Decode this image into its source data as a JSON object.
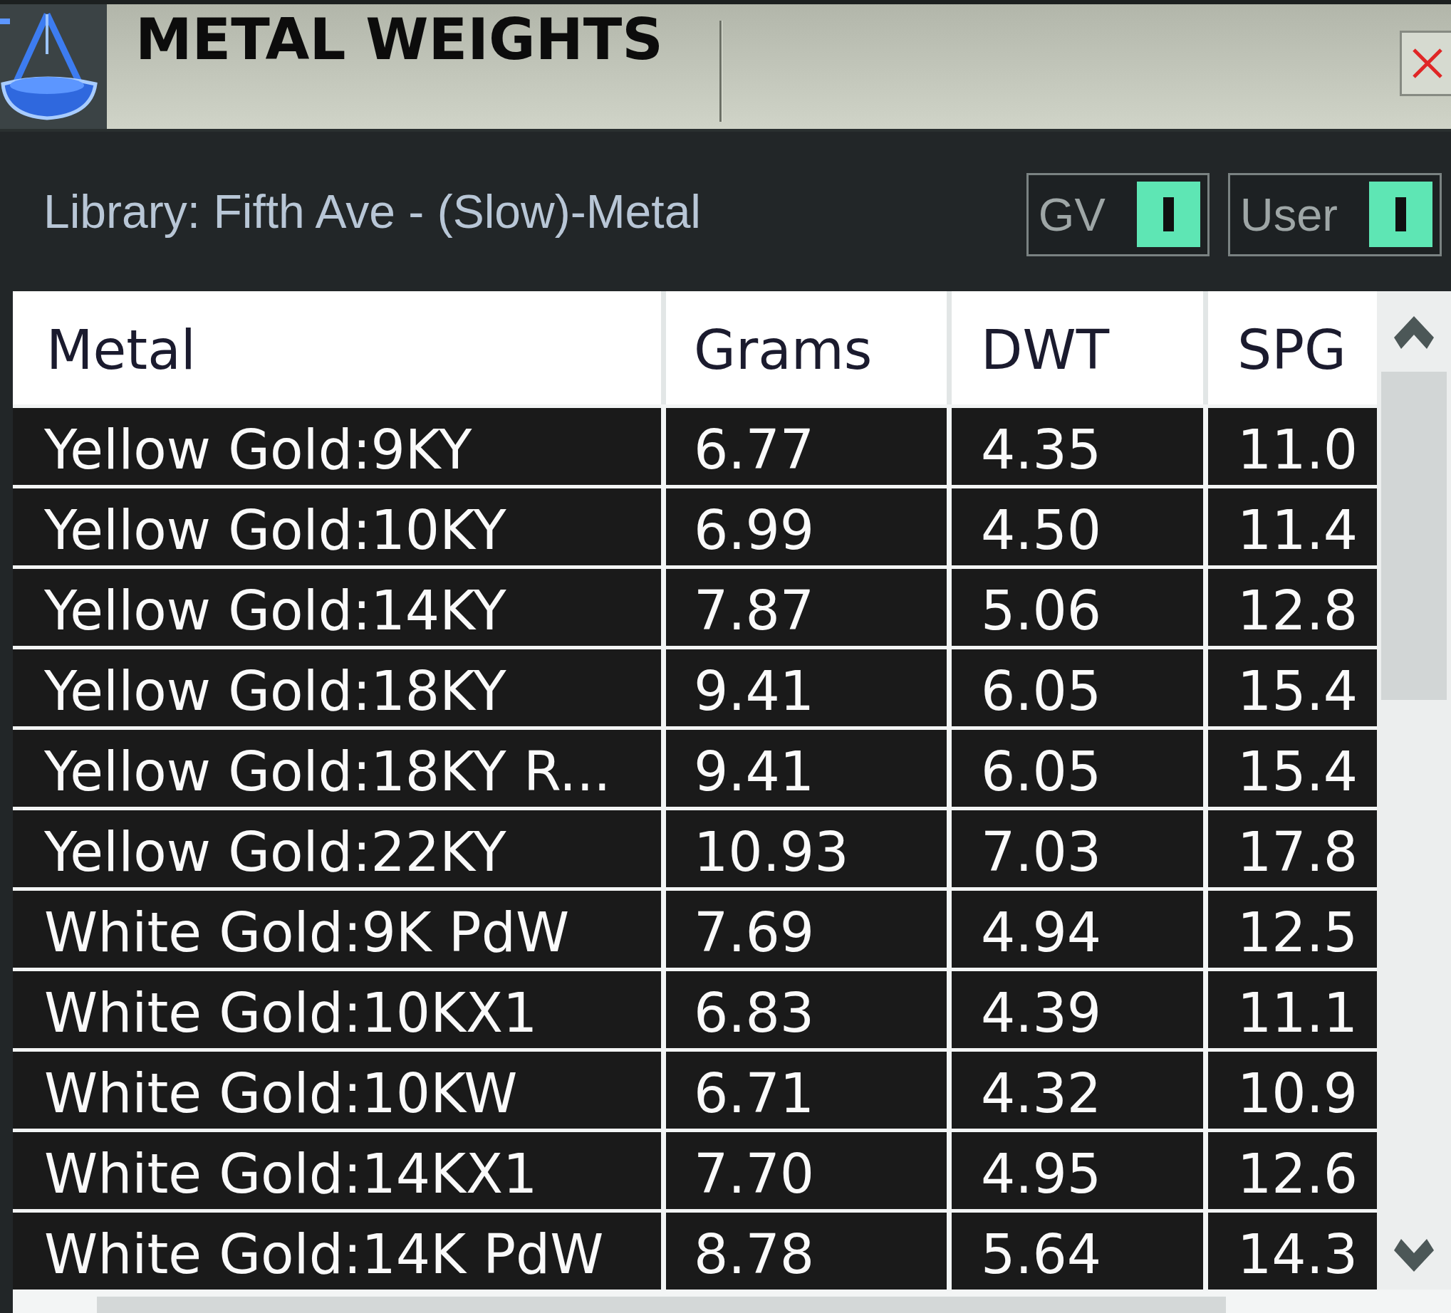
{
  "window": {
    "title": "METAL WEIGHTS"
  },
  "library": {
    "label": "Library: Fifth Ave - (Slow)-Metal"
  },
  "toggles": [
    {
      "label": "GV",
      "on": true
    },
    {
      "label": "User",
      "on": true
    }
  ],
  "table": {
    "columns": [
      "Metal",
      "Grams",
      "DWT",
      "SPG"
    ],
    "rows": [
      [
        "Yellow Gold:9KY",
        "6.77",
        "4.35",
        "11.0"
      ],
      [
        "Yellow Gold:10KY",
        "6.99",
        "4.50",
        "11.4"
      ],
      [
        "Yellow Gold:14KY",
        "7.87",
        "5.06",
        "12.8"
      ],
      [
        "Yellow Gold:18KY",
        "9.41",
        "6.05",
        "15.4"
      ],
      [
        "Yellow Gold:18KY R...",
        "9.41",
        "6.05",
        "15.4"
      ],
      [
        "Yellow Gold:22KY",
        "10.93",
        "7.03",
        "17.8"
      ],
      [
        "White Gold:9K PdW",
        "7.69",
        "4.94",
        "12.5"
      ],
      [
        "White Gold:10KX1",
        "6.83",
        "4.39",
        "11.1"
      ],
      [
        "White Gold:10KW",
        "6.71",
        "4.32",
        "10.9"
      ],
      [
        "White Gold:14KX1",
        "7.70",
        "4.95",
        "12.6"
      ],
      [
        "White Gold:14K PdW",
        "8.78",
        "5.64",
        "14.3"
      ]
    ]
  }
}
